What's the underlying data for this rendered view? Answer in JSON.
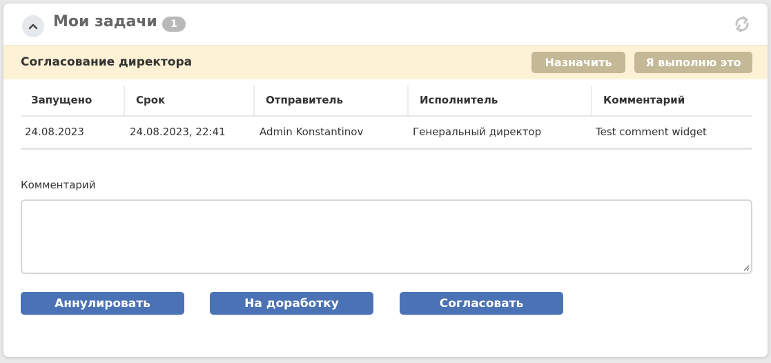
{
  "widget": {
    "title": "Мои задачи",
    "count": "1"
  },
  "task": {
    "title": "Согласование директора",
    "assign_label": "Назначить",
    "take_label": "Я выполню это"
  },
  "table": {
    "headers": [
      "Запущено",
      "Срок",
      "Отправитель",
      "Исполнитель",
      "Комментарий"
    ],
    "rows": [
      [
        "24.08.2023",
        "24.08.2023, 22:41",
        "Admin Konstantinov",
        "Генеральный директор",
        "Test comment widget"
      ]
    ]
  },
  "comment": {
    "label": "Комментарий",
    "value": "",
    "placeholder": ""
  },
  "actions": {
    "cancel_label": "Аннулировать",
    "rework_label": "На доработку",
    "approve_label": "Согласовать"
  },
  "colors": {
    "accent_blue": "#4a72b5",
    "tan_button": "#c4b896",
    "task_bar_bg": "#fdf2d5",
    "badge_gray": "#b9b9b9"
  },
  "icons": {
    "collapse": "chevron-up-icon",
    "refresh": "refresh-icon",
    "resize": "resize-grip-icon"
  }
}
